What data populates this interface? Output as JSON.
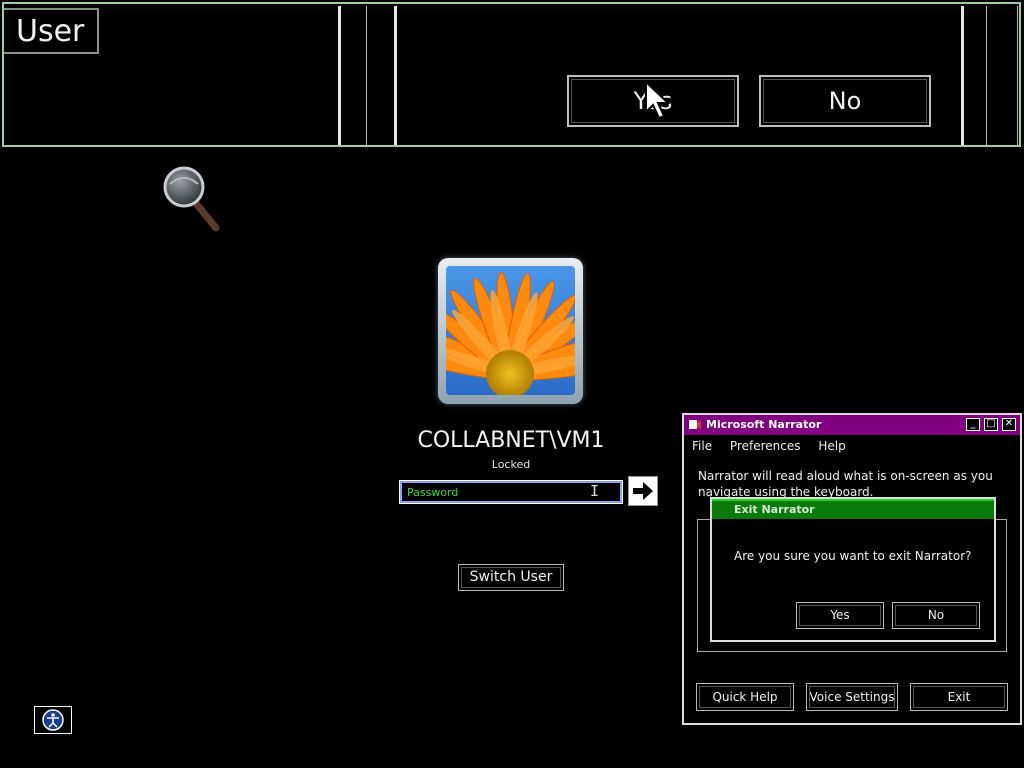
{
  "magnifier": {
    "user_label": "User",
    "yes_label": "Yes",
    "no_label": "No"
  },
  "logon": {
    "username": "COLLABNET\\VM1",
    "status": "Locked",
    "password_placeholder": "Password",
    "switch_user_label": "Switch User"
  },
  "narrator": {
    "title": "Microsoft Narrator",
    "menu": [
      "File",
      "Preferences",
      "Help"
    ],
    "message": "Narrator will read aloud what is on-screen as you navigate using the keyboard.",
    "buttons": {
      "quick_help": "Quick Help",
      "voice_settings": "Voice Settings",
      "exit": "Exit"
    }
  },
  "exit_dialog": {
    "title": "Exit Narrator",
    "message": "Are you sure you want to exit Narrator?",
    "yes": "Yes",
    "no": "No"
  },
  "colors": {
    "narrator_titlebar": "#800080",
    "exit_titlebar": "#0a7a0a",
    "password_text": "#33dd33"
  },
  "icons": [
    "magnifier-icon",
    "arrow-right-icon",
    "ease-of-access-icon",
    "narrator-app-icon"
  ]
}
